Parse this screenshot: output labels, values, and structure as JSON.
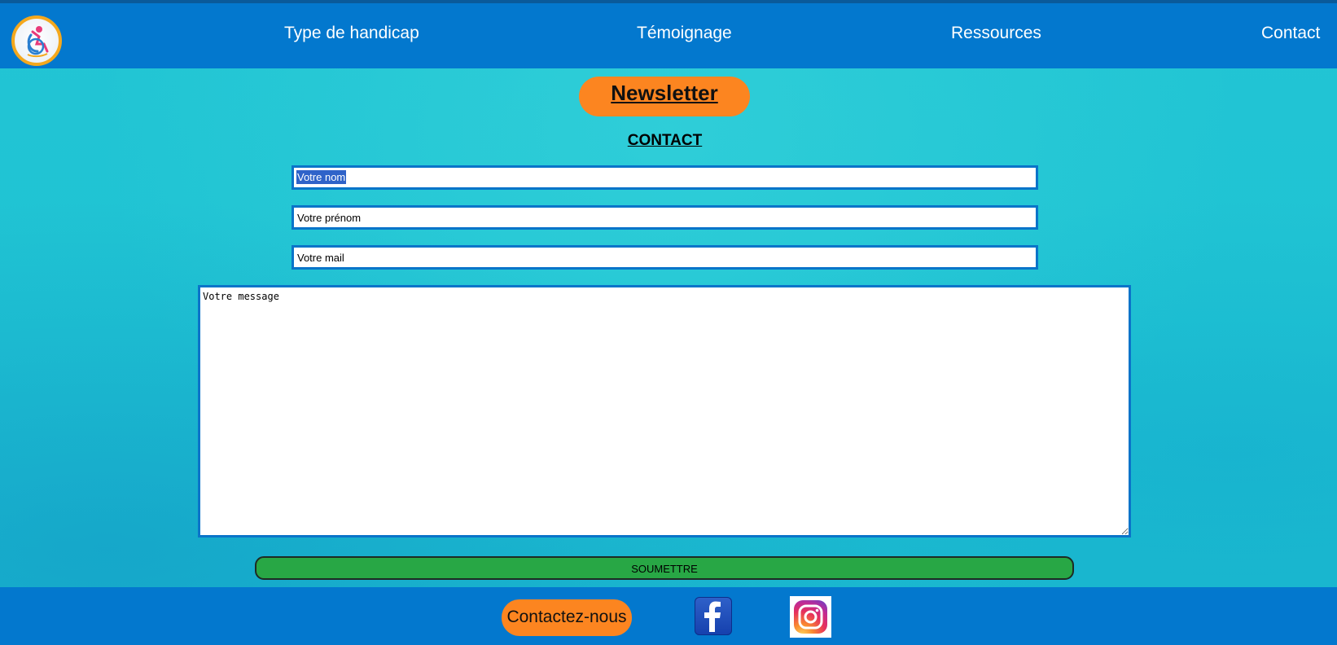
{
  "header": {
    "logo_icon": "wheelchair-logo-icon",
    "nav": [
      {
        "label": "Type de handicap"
      },
      {
        "label": "Témoignage"
      },
      {
        "label": "Ressources"
      },
      {
        "label": "Contact"
      }
    ]
  },
  "newsletter": {
    "label": "Newsletter"
  },
  "contact_form": {
    "title": "CONTACT",
    "nom": {
      "value": "Votre nom",
      "selected": true
    },
    "prenom": {
      "value": "Votre prénom"
    },
    "mail": {
      "value": "Votre mail"
    },
    "message": {
      "value": "Votre message"
    },
    "submit_label": "SOUMETTRE"
  },
  "footer": {
    "contact_label": "Contactez-nous",
    "social": [
      {
        "icon": "facebook-icon"
      },
      {
        "icon": "instagram-icon"
      }
    ]
  },
  "colors": {
    "navbar": "#0378ce",
    "accent_orange": "#fc8520",
    "submit_green": "#28a745",
    "field_border": "#0a74c9",
    "logo_ring": "#f4a81d",
    "background": "#1fc3d3"
  }
}
